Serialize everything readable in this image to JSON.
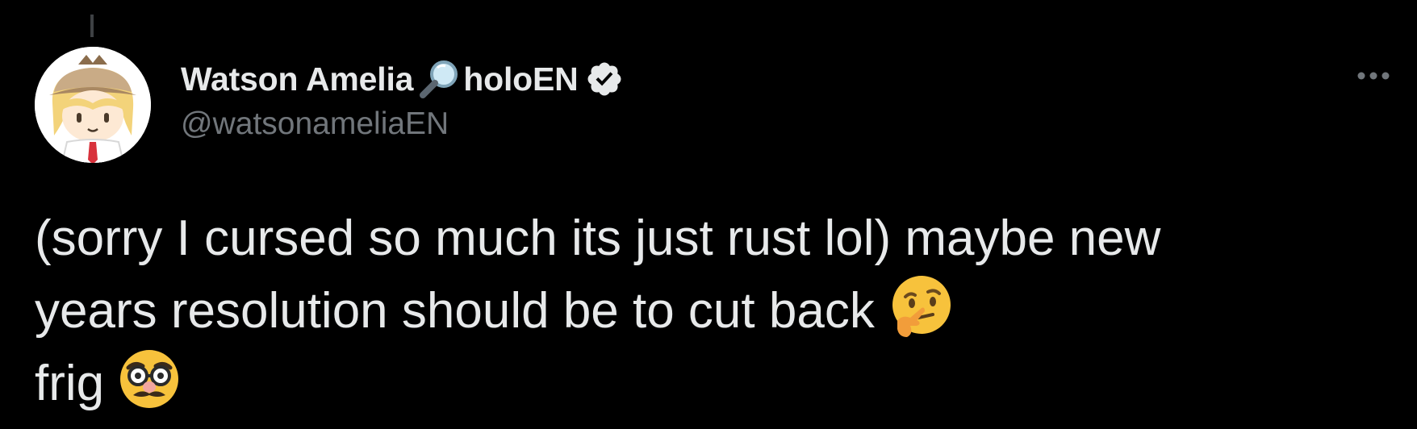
{
  "tweet": {
    "author": {
      "display_name": "Watson Amelia",
      "name_suffix": "holoEN",
      "handle": "@watsonameliaEN",
      "name_icon": "magnifying-glass-icon",
      "verified_icon": "verified-badge-icon"
    },
    "more_icon": "more-options-icon",
    "text_lines": [
      "(sorry I cursed so much its just rust lol) maybe new",
      "years resolution should be to cut back",
      "frig"
    ],
    "emojis": [
      "thinking-face-emoji",
      "disguised-face-emoji"
    ]
  },
  "colors": {
    "background": "#000000",
    "text_primary": "#e7e9ea",
    "text_secondary": "#71767b"
  }
}
